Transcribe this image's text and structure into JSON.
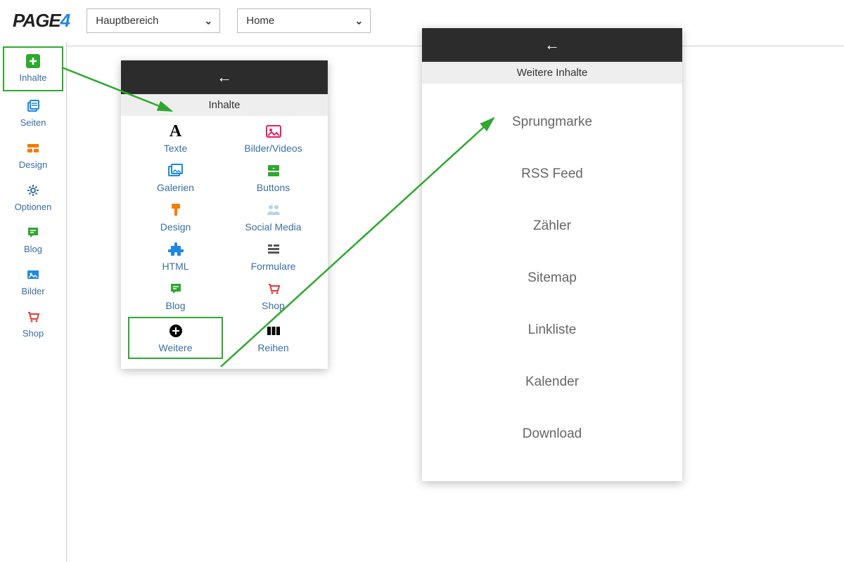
{
  "logo_prefix": "PAGE",
  "logo_suffix": "4",
  "dropdowns": {
    "area": "Hauptbereich",
    "page": "Home"
  },
  "sidebar": [
    {
      "label": "Inhalte",
      "active": true
    },
    {
      "label": "Seiten"
    },
    {
      "label": "Design"
    },
    {
      "label": "Optionen"
    },
    {
      "label": "Blog"
    },
    {
      "label": "Bilder"
    },
    {
      "label": "Shop"
    }
  ],
  "panel1": {
    "title": "Inhalte",
    "items": [
      {
        "label": "Texte"
      },
      {
        "label": "Bilder/Videos"
      },
      {
        "label": "Galerien"
      },
      {
        "label": "Buttons"
      },
      {
        "label": "Design"
      },
      {
        "label": "Social Media"
      },
      {
        "label": "HTML"
      },
      {
        "label": "Formulare"
      },
      {
        "label": "Blog"
      },
      {
        "label": "Shop"
      },
      {
        "label": "Weitere",
        "boxed": true
      },
      {
        "label": "Reihen"
      }
    ]
  },
  "panel2": {
    "title": "Weitere Inhalte",
    "items": [
      "Sprungmarke",
      "RSS Feed",
      "Zähler",
      "Sitemap",
      "Linkliste",
      "Kalender",
      "Download"
    ]
  }
}
